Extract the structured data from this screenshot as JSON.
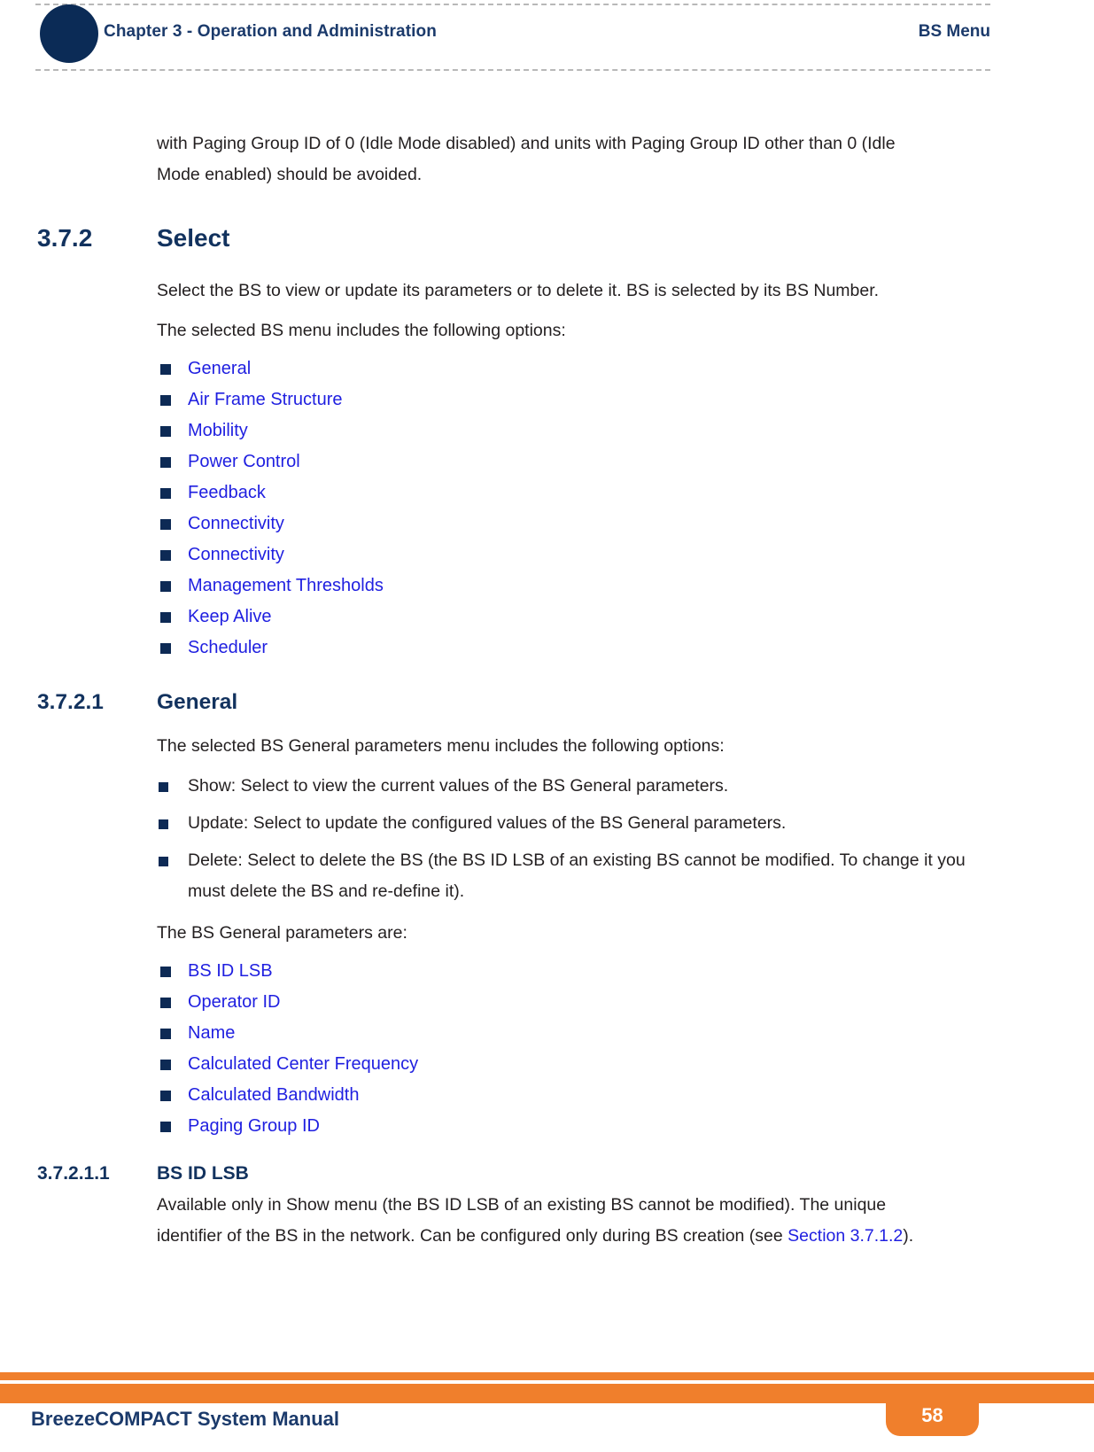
{
  "header": {
    "chapter": "Chapter 3 - Operation and Administration",
    "section": "BS Menu"
  },
  "body": {
    "intro_paragraph": "with Paging Group ID of 0 (Idle Mode disabled) and units with Paging Group ID other than 0 (Idle Mode enabled) should be avoided.",
    "section_372": {
      "number": "3.7.2",
      "title": "Select",
      "paragraph_1": "Select the BS to view or update its parameters or to delete it. BS is selected by its BS Number.",
      "paragraph_2": "The selected BS menu includes the following options:",
      "options": [
        "General",
        "Air Frame Structure",
        "Mobility",
        "Power Control",
        "Feedback",
        "Connectivity",
        "Connectivity",
        "Management Thresholds",
        "Keep Alive",
        "Scheduler"
      ]
    },
    "section_3721": {
      "number": "3.7.2.1",
      "title": "General",
      "paragraph_1": "The selected BS General parameters menu includes the following options:",
      "menu_options": [
        "Show: Select to view the current values of the BS General parameters.",
        "Update: Select to update the configured values of the BS General parameters.",
        "Delete: Select to delete the BS (the BS ID LSB of an existing BS cannot be modified. To change it you must delete the BS and re-define it)."
      ],
      "paragraph_2": "The BS General parameters are:",
      "parameters": [
        "BS ID LSB",
        "Operator ID",
        "Name",
        "Calculated Center Frequency",
        "Calculated Bandwidth",
        "Paging Group ID"
      ]
    },
    "section_37211": {
      "number": "3.7.2.1.1",
      "title": "BS ID LSB",
      "paragraph_lead": "Available only in Show menu (the BS ID LSB of an existing BS cannot be modified). The unique identifier of the BS in the network. Can be configured only during BS creation (see ",
      "paragraph_link": "Section 3.7.1.2",
      "paragraph_tail": ")."
    }
  },
  "footer": {
    "manual_title": "BreezeCOMPACT System Manual",
    "page_number": "58"
  },
  "colors": {
    "navy": "#12325e",
    "header_navy": "#1b3a6b",
    "link_blue": "#1f1fe0",
    "bullet_navy": "#0d2a55",
    "orange": "#f07f2c",
    "body_text": "#231f20"
  }
}
